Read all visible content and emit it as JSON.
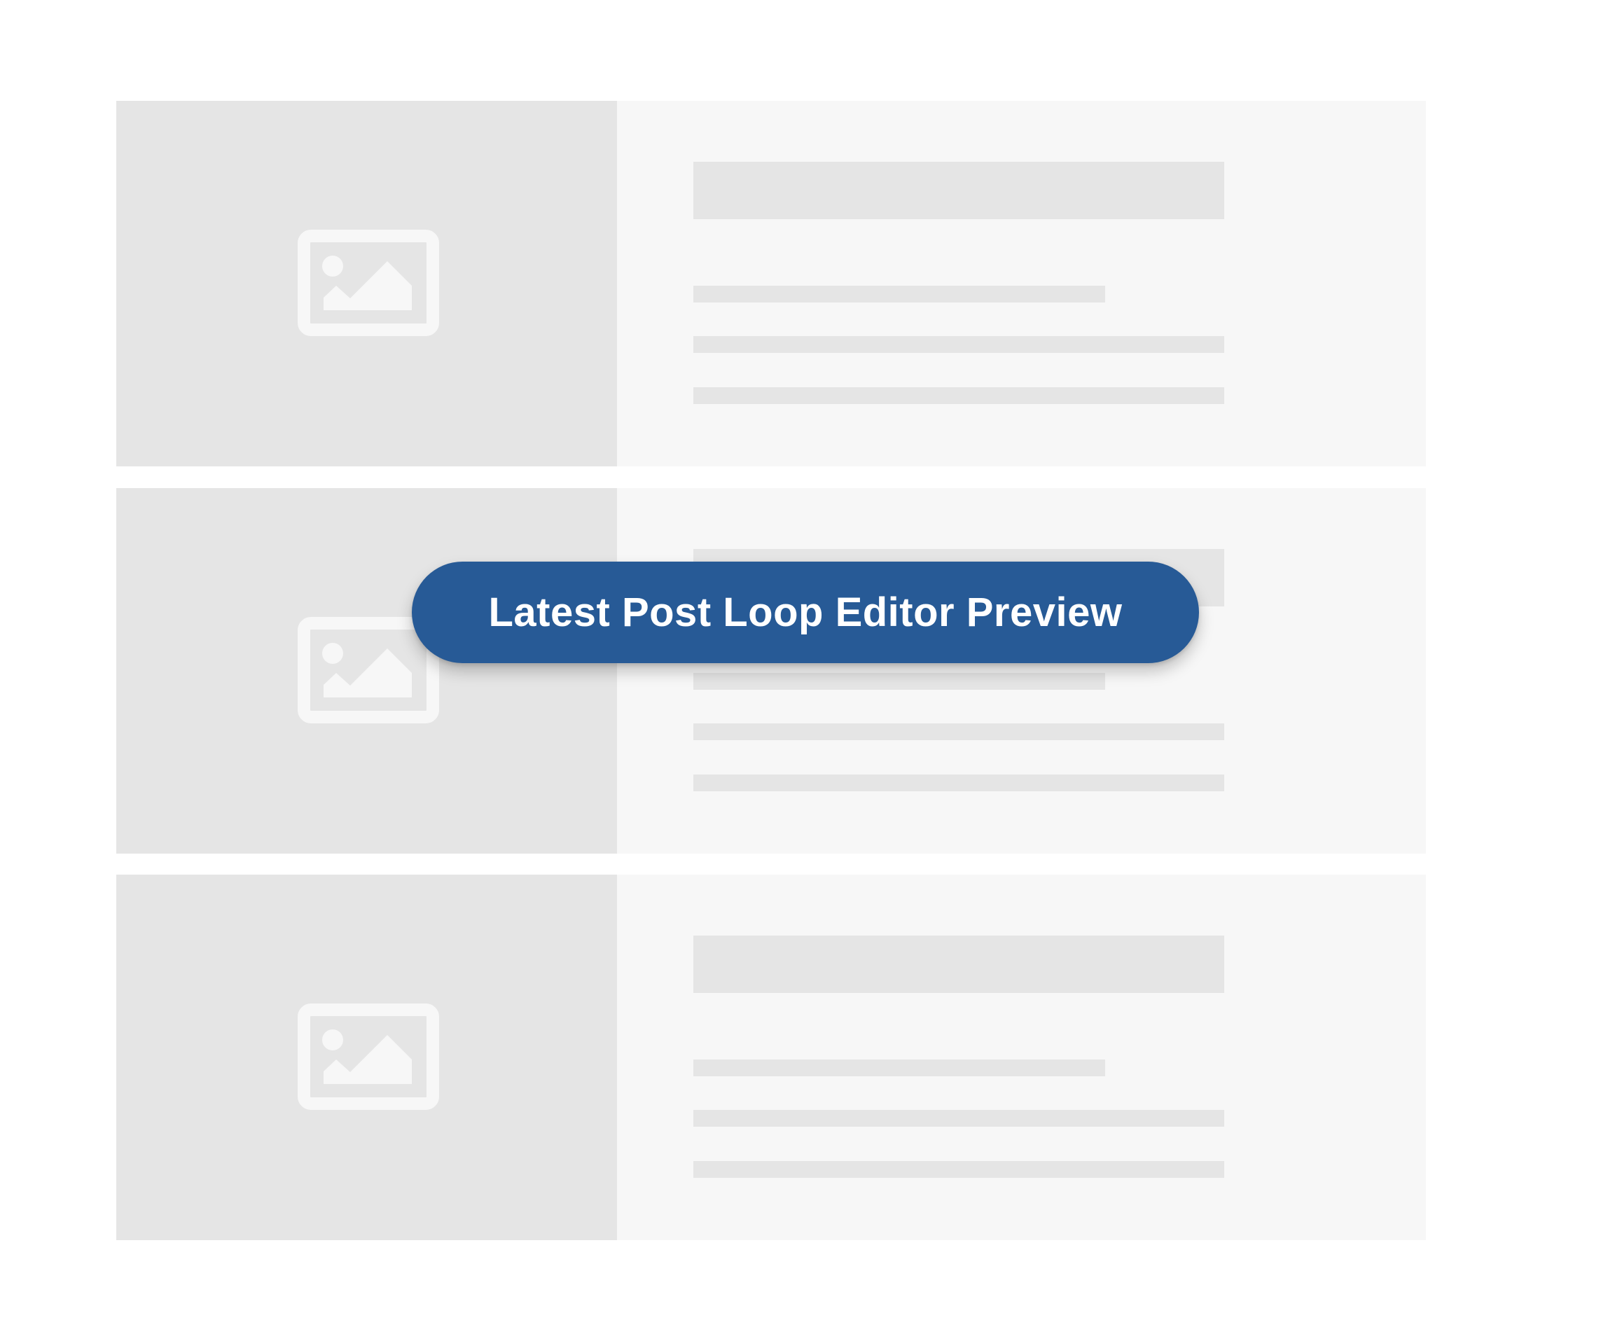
{
  "badge": {
    "label": "Latest Post Loop Editor Preview",
    "background_color": "#275a96",
    "text_color": "#ffffff"
  },
  "posts": [
    {
      "thumbnail_icon": "image-placeholder-icon"
    },
    {
      "thumbnail_icon": "image-placeholder-icon"
    },
    {
      "thumbnail_icon": "image-placeholder-icon"
    }
  ],
  "colors": {
    "page_background": "#ffffff",
    "card_background": "#f7f7f7",
    "placeholder": "#e5e5e5"
  }
}
